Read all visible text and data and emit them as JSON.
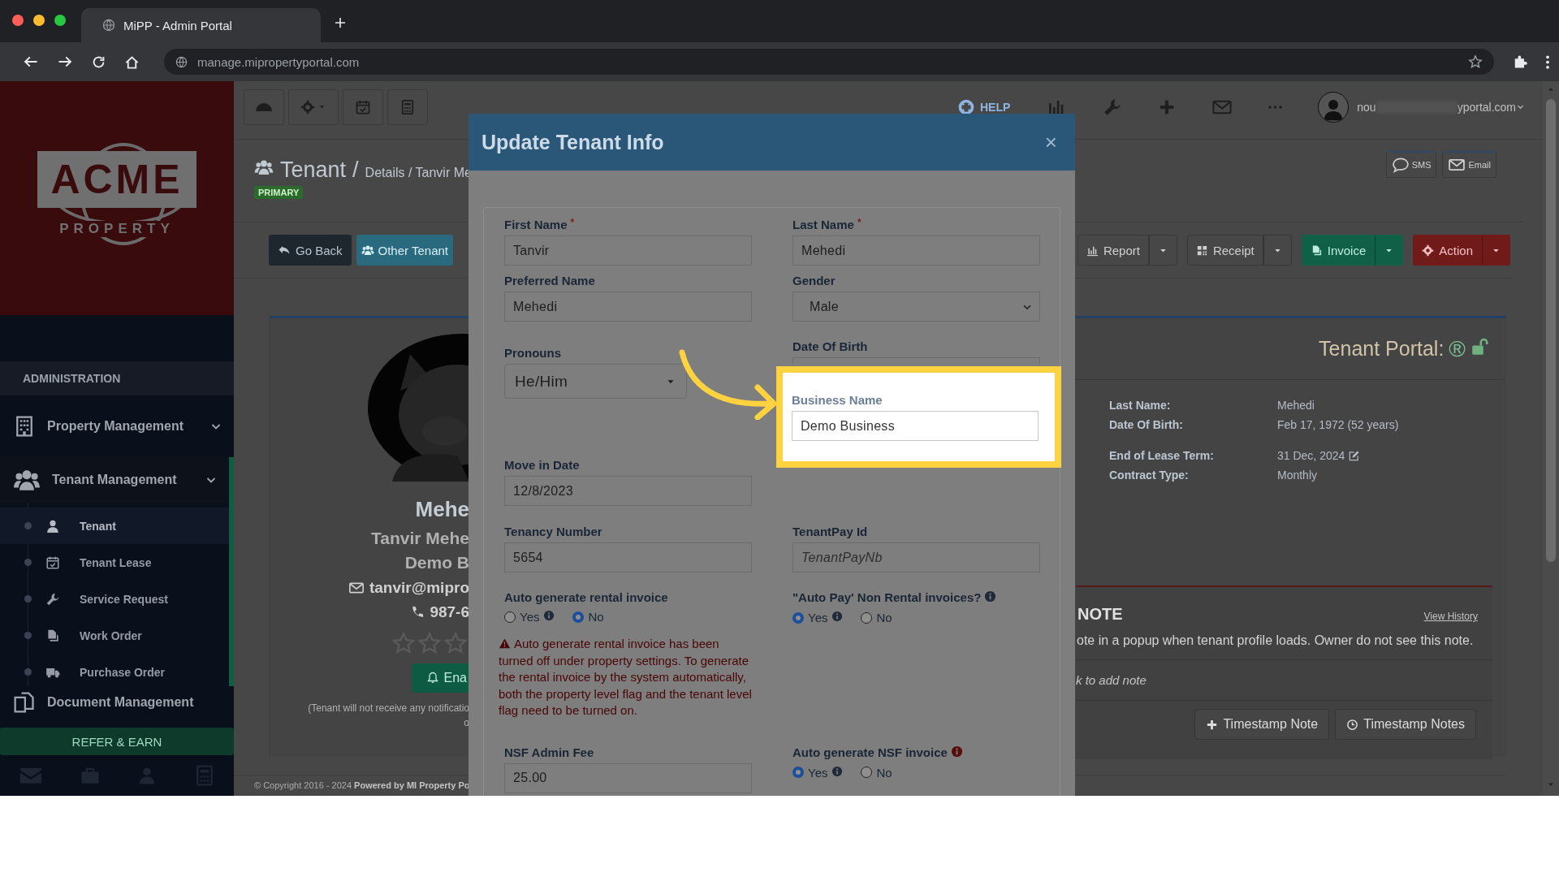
{
  "browser": {
    "tab_title": "MiPP - Admin Portal",
    "url": "manage.mipropertyportal.com"
  },
  "sidebar": {
    "logo": {
      "word": "ACME",
      "subword": "PROPERTY"
    },
    "section": "ADMINISTRATION",
    "groups": [
      {
        "label": "Property Management",
        "selected": false
      },
      {
        "label": "Tenant Management",
        "selected": true,
        "children": [
          {
            "label": "Tenant",
            "selected": true
          },
          {
            "label": "Tenant Lease",
            "selected": false
          },
          {
            "label": "Service Request",
            "selected": false
          },
          {
            "label": "Work Order",
            "selected": false
          },
          {
            "label": "Purchase Order",
            "selected": false
          }
        ]
      },
      {
        "label": "Document Management",
        "selected": false
      }
    ],
    "refer_button": "REFER & EARN"
  },
  "topbar": {
    "help": "HELP",
    "user_prefix": "nou",
    "user_suffix": "yportal.com"
  },
  "page": {
    "title": "Tenant",
    "title_separator": "/",
    "breadcrumb": "Details / Tanvir Me",
    "badge": "PRIMARY",
    "message_buttons": [
      "SMS",
      "Email"
    ],
    "left_buttons": [
      "Go Back",
      "Other Tenant"
    ],
    "action_buttons": [
      {
        "label": "Report",
        "kind": "default"
      },
      {
        "label": "Receipt",
        "kind": "default"
      },
      {
        "label": "Invoice",
        "kind": "success"
      },
      {
        "label": "Action",
        "kind": "danger"
      }
    ]
  },
  "profile": {
    "name": "Mehe",
    "full_name": "Tanvir Mehe",
    "business": "Demo B",
    "email": "tanvir@mipro",
    "phone": "987-6",
    "stars": 0,
    "notify_button": "Ena",
    "notice": [
      "(Tenant will not receive any notificatio",
      "o"
    ]
  },
  "portal": {
    "title": "Tenant Portal:",
    "registered_mark": "®",
    "detail_groups": [
      [
        {
          "label": "Last Name:",
          "value": "Mehedi",
          "editable": false
        },
        {
          "label": "Date Of Birth:",
          "value": "Feb 17, 1972 (52 years)",
          "editable": false
        }
      ],
      [
        {
          "label": "End of Lease Term:",
          "value": "31 Dec, 2024",
          "editable": true
        },
        {
          "label": "Contract Type:",
          "value": "Monthly",
          "editable": false
        }
      ]
    ]
  },
  "note": {
    "title": "NOTE",
    "history_link": "View History",
    "text": "ote in a popup when tenant profile loads. Owner do not see this note.",
    "add_hint": "k to add note",
    "buttons": [
      "Timestamp Note",
      "Timestamp Notes"
    ]
  },
  "footer": {
    "copyright": "© Copyright 2016 - 2024 **Powered by MI Property Po**"
  },
  "modal": {
    "title": "Update Tenant Info",
    "close": "×",
    "rows": [
      {
        "left": {
          "kind": "text",
          "label": "First Name",
          "required_mark": "*",
          "value": "Tanvir"
        },
        "right": {
          "kind": "text",
          "label": "Last Name",
          "required_mark": "*",
          "value": "Mehedi"
        }
      },
      {
        "left": {
          "kind": "text",
          "label": "Preferred Name",
          "value": "Mehedi"
        },
        "right": {
          "kind": "select",
          "label": "Gender",
          "value": "Male"
        }
      },
      {
        "left": {
          "kind": "dropdown",
          "label": "Pronouns",
          "value": "He/Him"
        },
        "right": {
          "kind": "text",
          "label": "Date Of Birth"
        }
      },
      {
        "left": {
          "kind": "text",
          "label": "Move in Date",
          "value": "12/8/2023"
        }
      },
      {
        "left": {
          "kind": "text",
          "label": "Tenancy Number",
          "value": "5654"
        },
        "right": {
          "kind": "text",
          "label": "TenantPay Id",
          "placeholder": "TenantPayNb"
        }
      },
      {
        "left": {
          "kind": "radio",
          "label": "Auto generate rental invoice",
          "options": [
            {
              "label": "Yes",
              "info": true,
              "selected": false
            },
            {
              "label": "No",
              "info": false,
              "selected": true
            }
          ]
        },
        "right": {
          "kind": "radio",
          "label": "\"Auto Pay' Non Rental invoices?",
          "info": true,
          "alert": false,
          "options": [
            {
              "label": "Yes",
              "info": true,
              "selected": true
            },
            {
              "label": "No",
              "info": false,
              "selected": false
            }
          ]
        }
      },
      {
        "left": {
          "kind": "warning",
          "text": "Auto generate rental invoice has been turned off under property settings. To generate the rental invoice by the system automatically, both the property level flag and the tenant level flag need to be turned on."
        }
      },
      {
        "left": {
          "kind": "text",
          "label": "NSF Admin Fee",
          "value": "25.00"
        },
        "right": {
          "kind": "radio",
          "label": "Auto generate NSF invoice",
          "info": true,
          "alert": true,
          "options": [
            {
              "label": "Yes",
              "info": true,
              "selected": true
            },
            {
              "label": "No",
              "info": false,
              "selected": false
            }
          ]
        }
      }
    ],
    "highlight": {
      "label": "Business Name",
      "value": "Demo Business"
    }
  }
}
